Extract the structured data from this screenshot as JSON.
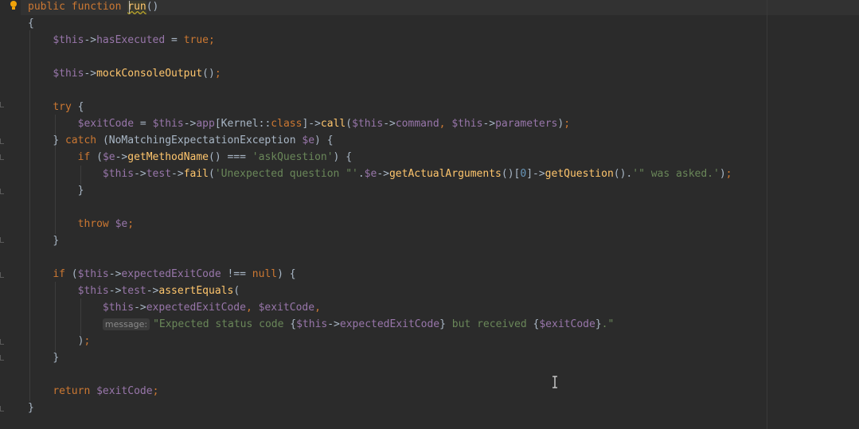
{
  "editor": {
    "inlay_hint": "message:",
    "lines": [
      {
        "tokens": [
          {
            "t": "public ",
            "c": "kw"
          },
          {
            "t": "function ",
            "c": "kw"
          },
          {
            "t": "run",
            "c": "fn caret-word"
          },
          {
            "t": "()",
            "c": "plain"
          }
        ]
      },
      {
        "tokens": [
          {
            "t": "{",
            "c": "plain"
          }
        ]
      },
      {
        "tokens": [
          {
            "t": "    "
          },
          {
            "t": "$this",
            "c": "var"
          },
          {
            "t": "->",
            "c": "plain"
          },
          {
            "t": "hasExecuted",
            "c": "var"
          },
          {
            "t": " = ",
            "c": "plain"
          },
          {
            "t": "true",
            "c": "kw"
          },
          {
            "t": ";",
            "c": "kw"
          }
        ]
      },
      {
        "tokens": []
      },
      {
        "tokens": [
          {
            "t": "    "
          },
          {
            "t": "$this",
            "c": "var"
          },
          {
            "t": "->",
            "c": "plain"
          },
          {
            "t": "mockConsoleOutput",
            "c": "fn"
          },
          {
            "t": "()",
            "c": "plain"
          },
          {
            "t": ";",
            "c": "kw"
          }
        ]
      },
      {
        "tokens": []
      },
      {
        "tokens": [
          {
            "t": "    "
          },
          {
            "t": "try ",
            "c": "kw"
          },
          {
            "t": "{",
            "c": "plain"
          }
        ]
      },
      {
        "tokens": [
          {
            "t": "        "
          },
          {
            "t": "$exitCode",
            "c": "var"
          },
          {
            "t": " = ",
            "c": "plain"
          },
          {
            "t": "$this",
            "c": "var"
          },
          {
            "t": "->",
            "c": "plain"
          },
          {
            "t": "app",
            "c": "var"
          },
          {
            "t": "[Kernel::",
            "c": "plain"
          },
          {
            "t": "class",
            "c": "kw"
          },
          {
            "t": "]->",
            "c": "plain"
          },
          {
            "t": "call",
            "c": "fn"
          },
          {
            "t": "(",
            "c": "plain"
          },
          {
            "t": "$this",
            "c": "var"
          },
          {
            "t": "->",
            "c": "plain"
          },
          {
            "t": "command",
            "c": "var"
          },
          {
            "t": ", ",
            "c": "kw"
          },
          {
            "t": "$this",
            "c": "var"
          },
          {
            "t": "->",
            "c": "plain"
          },
          {
            "t": "parameters",
            "c": "var"
          },
          {
            "t": ")",
            "c": "plain"
          },
          {
            "t": ";",
            "c": "kw"
          }
        ]
      },
      {
        "tokens": [
          {
            "t": "    "
          },
          {
            "t": "} ",
            "c": "plain"
          },
          {
            "t": "catch ",
            "c": "kw"
          },
          {
            "t": "(NoMatchingExpectationException ",
            "c": "plain"
          },
          {
            "t": "$e",
            "c": "var"
          },
          {
            "t": ") {",
            "c": "plain"
          }
        ]
      },
      {
        "tokens": [
          {
            "t": "        "
          },
          {
            "t": "if ",
            "c": "kw"
          },
          {
            "t": "(",
            "c": "plain"
          },
          {
            "t": "$e",
            "c": "var"
          },
          {
            "t": "->",
            "c": "plain"
          },
          {
            "t": "getMethodName",
            "c": "fn"
          },
          {
            "t": "() === ",
            "c": "plain"
          },
          {
            "t": "'askQuestion'",
            "c": "str"
          },
          {
            "t": ") {",
            "c": "plain"
          }
        ]
      },
      {
        "tokens": [
          {
            "t": "            "
          },
          {
            "t": "$this",
            "c": "var"
          },
          {
            "t": "->",
            "c": "plain"
          },
          {
            "t": "test",
            "c": "var"
          },
          {
            "t": "->",
            "c": "plain"
          },
          {
            "t": "fail",
            "c": "fn"
          },
          {
            "t": "(",
            "c": "plain"
          },
          {
            "t": "'Unexpected question \"'",
            "c": "str"
          },
          {
            "t": ".",
            "c": "plain"
          },
          {
            "t": "$e",
            "c": "var"
          },
          {
            "t": "->",
            "c": "plain"
          },
          {
            "t": "getActualArguments",
            "c": "fn"
          },
          {
            "t": "()[",
            "c": "plain"
          },
          {
            "t": "0",
            "c": "num"
          },
          {
            "t": "]->",
            "c": "plain"
          },
          {
            "t": "getQuestion",
            "c": "fn"
          },
          {
            "t": "().",
            "c": "plain"
          },
          {
            "t": "'\" was asked.'",
            "c": "str"
          },
          {
            "t": ")",
            "c": "plain"
          },
          {
            "t": ";",
            "c": "kw"
          }
        ]
      },
      {
        "tokens": [
          {
            "t": "        "
          },
          {
            "t": "}",
            "c": "plain"
          }
        ]
      },
      {
        "tokens": []
      },
      {
        "tokens": [
          {
            "t": "        "
          },
          {
            "t": "throw ",
            "c": "kw"
          },
          {
            "t": "$e",
            "c": "var"
          },
          {
            "t": ";",
            "c": "kw"
          }
        ]
      },
      {
        "tokens": [
          {
            "t": "    "
          },
          {
            "t": "}",
            "c": "plain"
          }
        ]
      },
      {
        "tokens": []
      },
      {
        "tokens": [
          {
            "t": "    "
          },
          {
            "t": "if ",
            "c": "kw"
          },
          {
            "t": "(",
            "c": "plain"
          },
          {
            "t": "$this",
            "c": "var"
          },
          {
            "t": "->",
            "c": "plain"
          },
          {
            "t": "expectedExitCode",
            "c": "var"
          },
          {
            "t": " !== ",
            "c": "plain"
          },
          {
            "t": "null",
            "c": "kw"
          },
          {
            "t": ") {",
            "c": "plain"
          }
        ]
      },
      {
        "tokens": [
          {
            "t": "        "
          },
          {
            "t": "$this",
            "c": "var"
          },
          {
            "t": "->",
            "c": "plain"
          },
          {
            "t": "test",
            "c": "var"
          },
          {
            "t": "->",
            "c": "plain"
          },
          {
            "t": "assertEquals",
            "c": "fn"
          },
          {
            "t": "(",
            "c": "plain"
          }
        ]
      },
      {
        "tokens": [
          {
            "t": "            "
          },
          {
            "t": "$this",
            "c": "var"
          },
          {
            "t": "->",
            "c": "plain"
          },
          {
            "t": "expectedExitCode",
            "c": "var"
          },
          {
            "t": ", ",
            "c": "kw"
          },
          {
            "t": "$exitCode",
            "c": "var"
          },
          {
            "t": ",",
            "c": "kw"
          }
        ]
      },
      {
        "tokens": [
          {
            "t": "            "
          },
          {
            "hint": true
          },
          {
            "t": "\"Expected status code ",
            "c": "str"
          },
          {
            "t": "{",
            "c": "plain"
          },
          {
            "t": "$this",
            "c": "var"
          },
          {
            "t": "->",
            "c": "plain"
          },
          {
            "t": "expectedExitCode",
            "c": "var"
          },
          {
            "t": "}",
            "c": "plain"
          },
          {
            "t": " but received ",
            "c": "str"
          },
          {
            "t": "{",
            "c": "plain"
          },
          {
            "t": "$exitCode",
            "c": "var"
          },
          {
            "t": "}",
            "c": "plain"
          },
          {
            "t": ".\"",
            "c": "str"
          }
        ]
      },
      {
        "tokens": [
          {
            "t": "        "
          },
          {
            "t": ")",
            "c": "plain"
          },
          {
            "t": ";",
            "c": "kw"
          }
        ]
      },
      {
        "tokens": [
          {
            "t": "    "
          },
          {
            "t": "}",
            "c": "plain"
          }
        ]
      },
      {
        "tokens": []
      },
      {
        "tokens": [
          {
            "t": "    "
          },
          {
            "t": "return ",
            "c": "kw"
          },
          {
            "t": "$exitCode",
            "c": "var"
          },
          {
            "t": ";",
            "c": "kw"
          }
        ]
      },
      {
        "tokens": [
          {
            "t": "}",
            "c": "plain"
          }
        ]
      }
    ]
  }
}
